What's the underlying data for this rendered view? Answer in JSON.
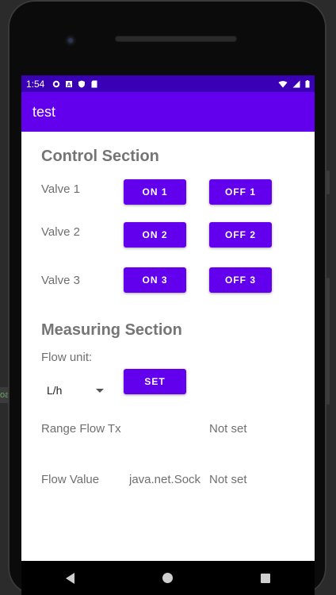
{
  "status_bar": {
    "time": "1:54",
    "left_icons": [
      "settings-icon",
      "a-icon",
      "shield-icon",
      "sd-card-icon"
    ],
    "right_icons": [
      "wifi-icon",
      "cell-signal-icon",
      "battery-icon"
    ]
  },
  "app_bar": {
    "title": "test"
  },
  "control_section": {
    "title": "Control Section",
    "valves": [
      {
        "label": "Valve 1",
        "on": "ON 1",
        "off": "OFF 1"
      },
      {
        "label": "Valve 2",
        "on": "ON 2",
        "off": "OFF 2"
      },
      {
        "label": "Valve 3",
        "on": "ON 3",
        "off": "OFF 3"
      }
    ]
  },
  "measuring_section": {
    "title": "Measuring Section",
    "flow_unit_label": "Flow unit:",
    "flow_unit_selected": "L/h",
    "set_button": "SET",
    "range_label": "Range Flow Tx",
    "range_value": "Not set",
    "flow_value_label": "Flow Value",
    "flow_value_text": "java.net.Sock",
    "flow_value_status": "Not set"
  },
  "nav_bar": {
    "buttons": [
      "back-icon",
      "home-icon",
      "recents-icon"
    ]
  },
  "colors": {
    "primary": "#6200ee",
    "primary_dark": "#3700b3",
    "label_gray": "#757575"
  }
}
